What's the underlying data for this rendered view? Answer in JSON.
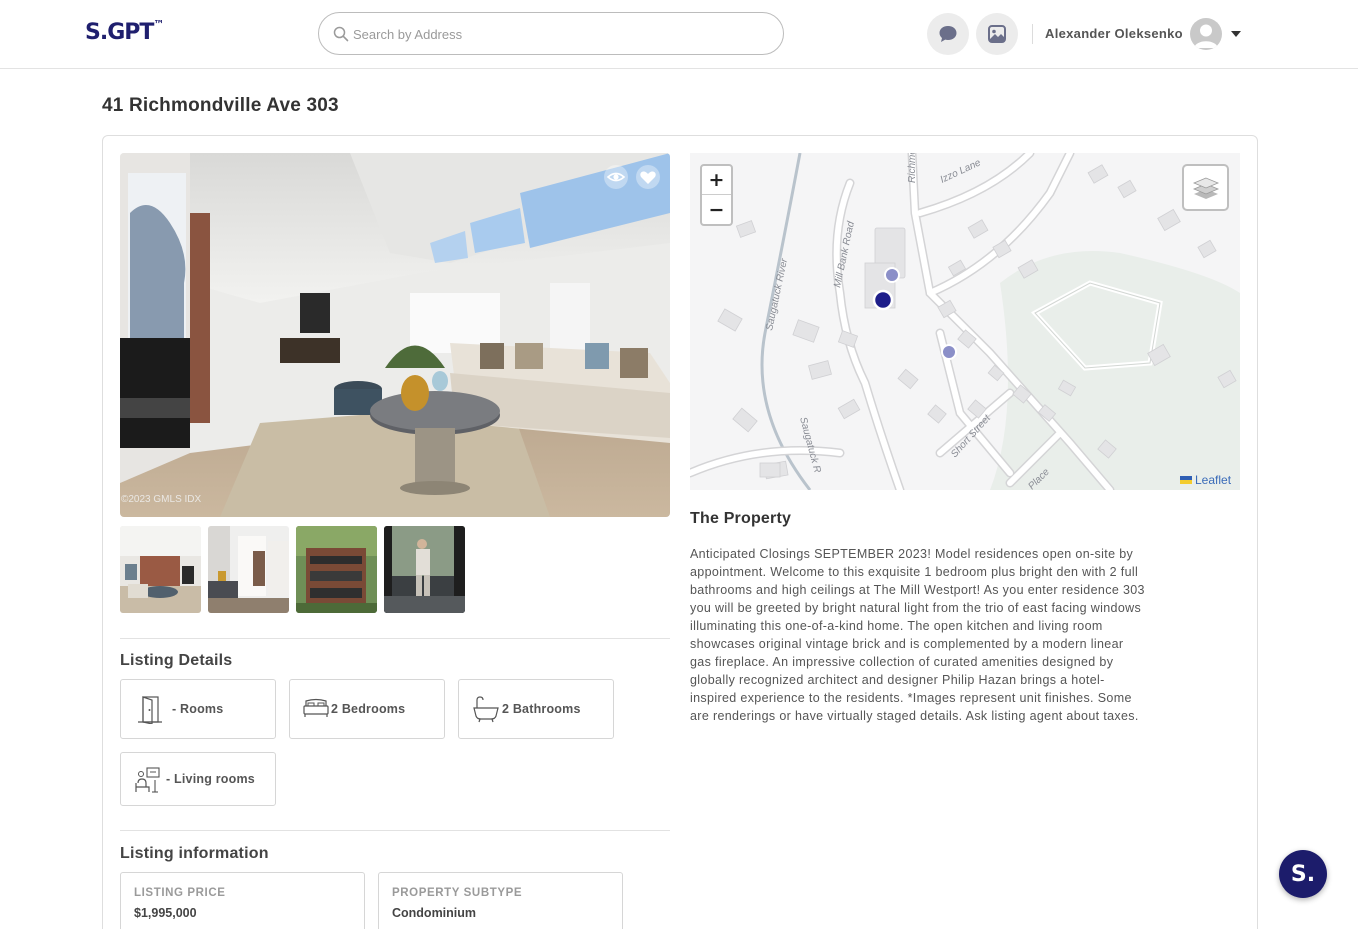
{
  "header": {
    "logo": "S.GPT",
    "logo_mark": "™",
    "search_placeholder": "Search by Address",
    "user_name": "Alexander Oleksenko",
    "icons": [
      "search-icon",
      "chat-icon",
      "image-icon",
      "user-avatar-icon",
      "caret-down-icon"
    ]
  },
  "listing": {
    "address": "41 Richmondville Ave 303",
    "photo_credit": "©2023 GMLS IDX",
    "thumbnails": [
      "thumb-living",
      "thumb-bathroom",
      "thumb-exterior",
      "thumb-interior-people"
    ]
  },
  "listing_details": {
    "title": "Listing Details",
    "items": [
      {
        "icon": "door-icon",
        "label": "- Rooms"
      },
      {
        "icon": "bed-icon",
        "label": "2 Bedrooms"
      },
      {
        "icon": "bathtub-icon",
        "label": "2 Bathrooms"
      },
      {
        "icon": "living-room-icon",
        "label": "- Living rooms"
      }
    ]
  },
  "listing_information": {
    "title": "Listing information",
    "items": [
      {
        "key": "LISTING PRICE",
        "value": "$1,995,000"
      },
      {
        "key": "PROPERTY SUBTYPE",
        "value": "Condominium"
      }
    ]
  },
  "map": {
    "zoom_in": "+",
    "zoom_out": "−",
    "attribution": "Leaflet",
    "street_labels": [
      "Izzo Lane",
      "Richmond",
      "Mill Bank Road",
      "Saugatuck River",
      "Saugatuck",
      "Short Street",
      "Place"
    ]
  },
  "property": {
    "title": "The Property",
    "description": "Anticipated Closings SEPTEMBER 2023! Model residences open on-site by appointment. Welcome to this exquisite 1 bedroom plus bright den with 2 full bathrooms and high ceilings at The Mill Westport! As you enter residence 303 you will be greeted by bright natural light from the trio of east facing windows illuminating this one-of-a-kind home. The open kitchen and living room showcases original vintage brick and is complemented by a modern linear gas fireplace. An impressive collection of curated amenities designed by globally recognized architect and designer Philip Hazan brings a hotel-inspired experience to the residents. *Images represent unit finishes. Some are renderings or have virtually staged details. Ask listing agent about taxes."
  },
  "chat_fab": {
    "label": "S."
  }
}
